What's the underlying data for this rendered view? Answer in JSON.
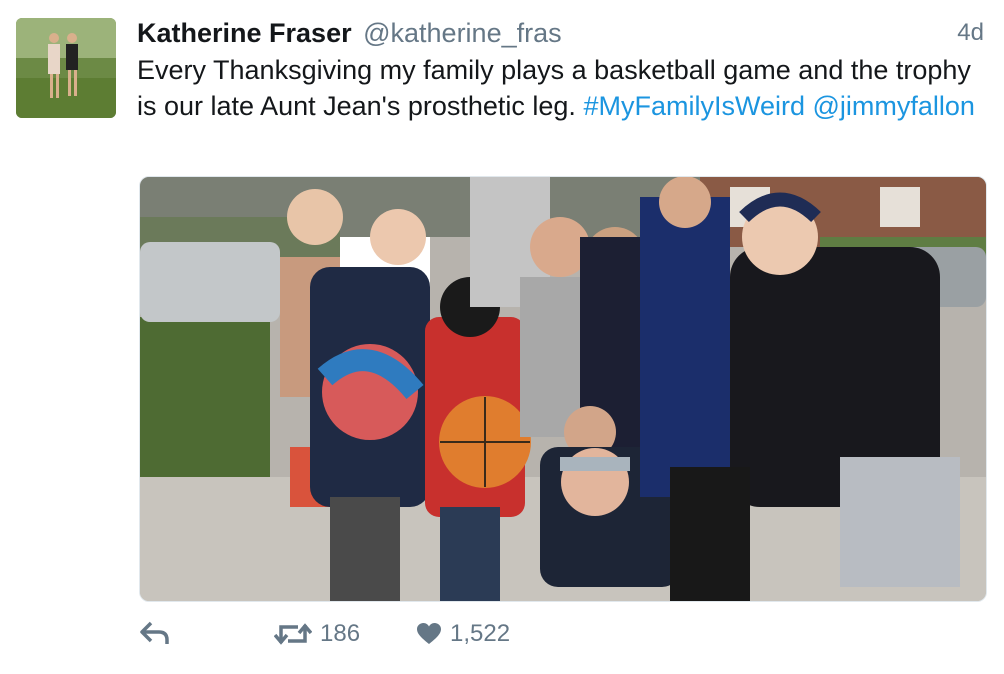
{
  "tweet": {
    "author_name": "Katherine Fraser",
    "author_handle": "@katherine_fras",
    "timestamp": "4d",
    "text_plain": "Every Thanksgiving my family plays a basketball game and the trophy is our late Aunt Jean's prosthetic leg.",
    "hashtag": "#MyFamilyIsWeird",
    "mention": "@jimmyfallon"
  },
  "actions": {
    "reply_icon": "reply-icon",
    "retweet_icon": "retweet-icon",
    "retweet_count": "186",
    "like_icon": "heart-icon",
    "like_count": "1,522"
  },
  "colors": {
    "link": "#1b95e0",
    "muted": "#657786",
    "text": "#14171a"
  }
}
